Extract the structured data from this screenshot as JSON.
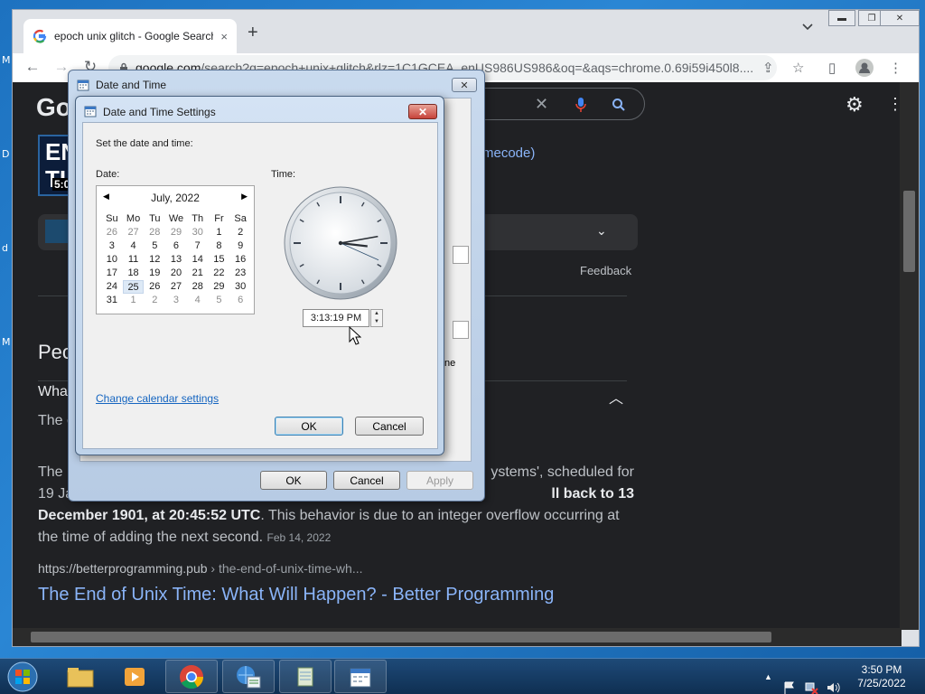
{
  "desktop": {
    "side_letters": [
      "M",
      "D",
      "d",
      "M"
    ]
  },
  "browser": {
    "tab_title": "epoch unix glitch - Google Search",
    "tab_close": "×",
    "new_tab": "+",
    "tab_search_icon": "chevron-down",
    "url_host": "google.com",
    "url_path": "/search?q=epoch+unix+glitch&rlz=1C1GCEA_enUS986US986&oq=&aqs=chrome.0.69i59i450l8....",
    "window_controls": [
      "minimize",
      "maximize",
      "close"
    ]
  },
  "google_page": {
    "logo": "Go",
    "thumb_text": "EN\nTI",
    "thumb_sub": "5:0",
    "link_fragment": "mecode)",
    "feedback": "Feedback",
    "paa_heading": "Peo",
    "question": "What",
    "short_snippet": "The e",
    "snippet_line1_start": "The m",
    "snippet_line1_end": "ystems', scheduled for",
    "snippet_line2_start": "19 Ja",
    "snippet_line2_bold_end": "ll back to 13",
    "snippet_bold": "December 1901, at 20:45:52 UTC",
    "snippet_rest": ". This behavior is due to an integer overflow occurring at the time of adding the next second.",
    "snippet_date": "Feb 14, 2022",
    "cite_host": "https://betterprogramming.pub",
    "cite_path": " › the-end-of-unix-time-wh...",
    "result_title": "The End of Unix Time: What Will Happen? - Better Programming"
  },
  "date_time_dialog": {
    "title": "Date and Time",
    "close": "✕",
    "ghost_text": "ne",
    "ok": "OK",
    "cancel": "Cancel",
    "apply": "Apply"
  },
  "settings_dialog": {
    "title": "Date and Time Settings",
    "close": "✕",
    "instruction": "Set the date and time:",
    "date_label": "Date:",
    "time_label": "Time:",
    "month_year": "July, 2022",
    "prev_arrow": "◀",
    "next_arrow": "▶",
    "weekdays": [
      "Su",
      "Mo",
      "Tu",
      "We",
      "Th",
      "Fr",
      "Sa"
    ],
    "days": [
      [
        "26",
        "27",
        "28",
        "29",
        "30",
        "1",
        "2"
      ],
      [
        "3",
        "4",
        "5",
        "6",
        "7",
        "8",
        "9"
      ],
      [
        "10",
        "11",
        "12",
        "13",
        "14",
        "15",
        "16"
      ],
      [
        "17",
        "18",
        "19",
        "20",
        "21",
        "22",
        "23"
      ],
      [
        "24",
        "25",
        "26",
        "27",
        "28",
        "29",
        "30"
      ],
      [
        "31",
        "1",
        "2",
        "3",
        "4",
        "5",
        "6"
      ]
    ],
    "selected_day": "25",
    "time_value": "3:13:19 PM",
    "clock": {
      "hour": 3,
      "minute": 13,
      "second": 19
    },
    "change_calendar_link": "Change calendar settings",
    "ok": "OK",
    "cancel": "Cancel"
  },
  "taskbar": {
    "apps": [
      "start-orb",
      "file-explorer",
      "media-player",
      "chrome",
      "control-panel",
      "notepad",
      "date-time"
    ],
    "clock_time": "3:50 PM",
    "clock_date": "7/25/2022",
    "tray_arrow": "▲"
  },
  "colors": {
    "accent": "#1565c0",
    "page_bg": "#202124",
    "link": "#8ab4f8"
  }
}
